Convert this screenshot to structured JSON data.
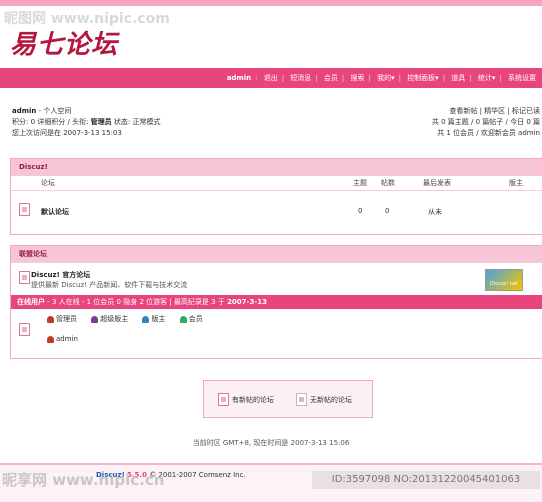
{
  "watermark": {
    "tl": "昵图网 www.nipic.com",
    "bl": "昵享网 www.nipic.cn",
    "br": "ID:3597098 NO:20131220045401063"
  },
  "logo": {
    "text": "易七论坛"
  },
  "nav": {
    "user": "admin",
    "items": [
      "退出",
      "短消息",
      "会员",
      "搜索",
      "我的▾",
      "控制面板▾",
      "道具",
      "统计▾",
      "系统设置"
    ]
  },
  "user_info": {
    "line1_name": "admin",
    "line1_suffix": " - 个人空间",
    "line2": "积分: 0 详细积分 / 头衔:",
    "line2_title": "管理员",
    "line2_status": "状态: 正常模式",
    "line3": "您上次访问是在 2007-3-13 15:03"
  },
  "right_links": {
    "row1": [
      "查看新帖",
      "精华区",
      "标记已读"
    ],
    "row2": "共 0 篇主题 / 0 篇帖子 / 今日 0 篇",
    "row3": "共 1 位会员 / 欢迎新会员 admin"
  },
  "forum_panel": {
    "title": "Discuz!",
    "columns": [
      "论坛",
      "主题",
      "帖数",
      "最后发表",
      "版主"
    ],
    "rows": [
      {
        "name": "默认论坛",
        "topics": "0",
        "posts": "0",
        "last": "从未",
        "mod": ""
      }
    ]
  },
  "links_panel": {
    "title": "联盟论坛",
    "name": "Discuz! 官方论坛",
    "desc": "提供最新 Discuz! 产品新闻、软件下载与技术交流",
    "badge": "Discuz! net"
  },
  "online": {
    "label": "在线用户",
    "text": " - 3 人在线 - 1 位会员 0 隐身 2 位游客 | 最高纪录是 3 于 ",
    "date": "2007-3-13",
    "roles": [
      "管理员",
      "超级版主",
      "版主",
      "会员"
    ],
    "role_colors": [
      "#c0392b",
      "#7d3c98",
      "#2e86c1",
      "#27ae60"
    ],
    "members": [
      "admin"
    ]
  },
  "legend": {
    "new": "有新帖的论坛",
    "none": "无新帖的论坛"
  },
  "timezone": "当前时区 GMT+8, 现在时间是 2007-3-13 15:06",
  "footer": {
    "brand": "Discuz!",
    "version": "5.5.0",
    "copyright": "© 2001-2007 Comsenz Inc."
  }
}
